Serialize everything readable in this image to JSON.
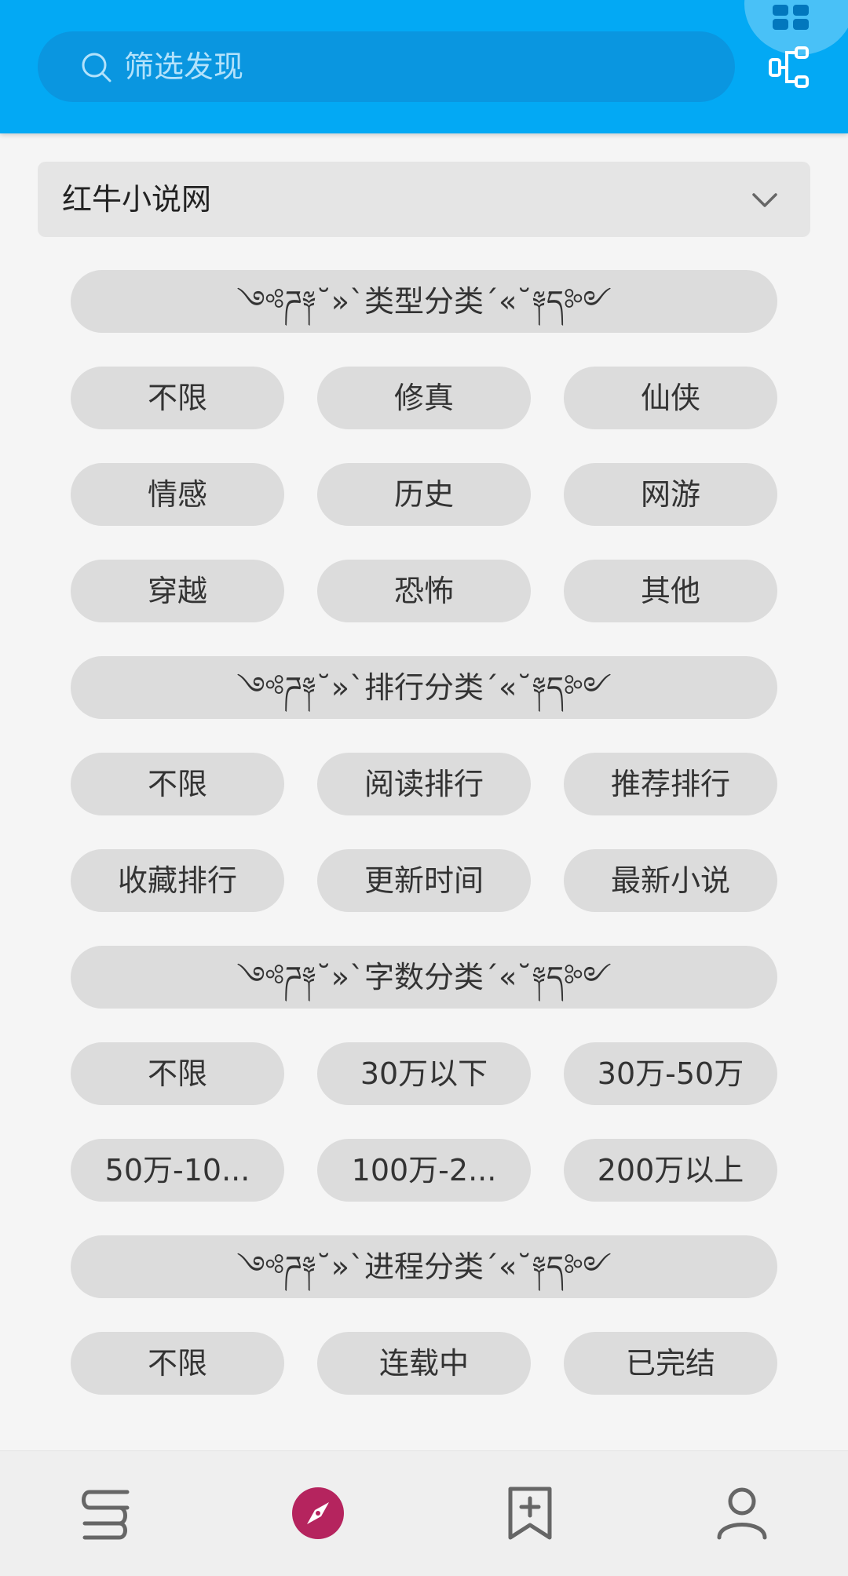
{
  "search": {
    "placeholder": "筛选发现",
    "icon": "search-icon"
  },
  "header_actions": [
    {
      "name": "grid-icon",
      "color": "#0277bd"
    },
    {
      "name": "tree-icon",
      "color": "#ffffff"
    }
  ],
  "source": {
    "selected": "红牛小说网"
  },
  "sections": [
    {
      "title": "༺ཌ༈˘»`类型分类´«˘༈ད༻",
      "options": [
        "不限",
        "修真",
        "仙侠",
        "情感",
        "历史",
        "网游",
        "穿越",
        "恐怖",
        "其他"
      ]
    },
    {
      "title": "༺ཌ༈˘»`排行分类´«˘༈ད༻",
      "options": [
        "不限",
        "阅读排行",
        "推荐排行",
        "收藏排行",
        "更新时间",
        "最新小说"
      ]
    },
    {
      "title": "༺ཌ༈˘»`字数分类´«˘༈ད༻",
      "options": [
        "不限",
        "30万以下",
        "30万-50万",
        "50万-10...",
        "100万-2...",
        "200万以上"
      ]
    },
    {
      "title": "༺ཌ༈˘»`进程分类´«˘༈ད༻",
      "options": [
        "不限",
        "连载中",
        "已完结"
      ]
    }
  ],
  "bottom_nav": [
    {
      "name": "bookshelf-icon",
      "active": false
    },
    {
      "name": "compass-icon",
      "active": true,
      "color": "#b5245e"
    },
    {
      "name": "bookmark-add-icon",
      "active": false
    },
    {
      "name": "profile-icon",
      "active": false
    }
  ],
  "colors": {
    "primary": "#03a9f4",
    "accent": "#b5245e",
    "pill": "#dcdcdc"
  }
}
